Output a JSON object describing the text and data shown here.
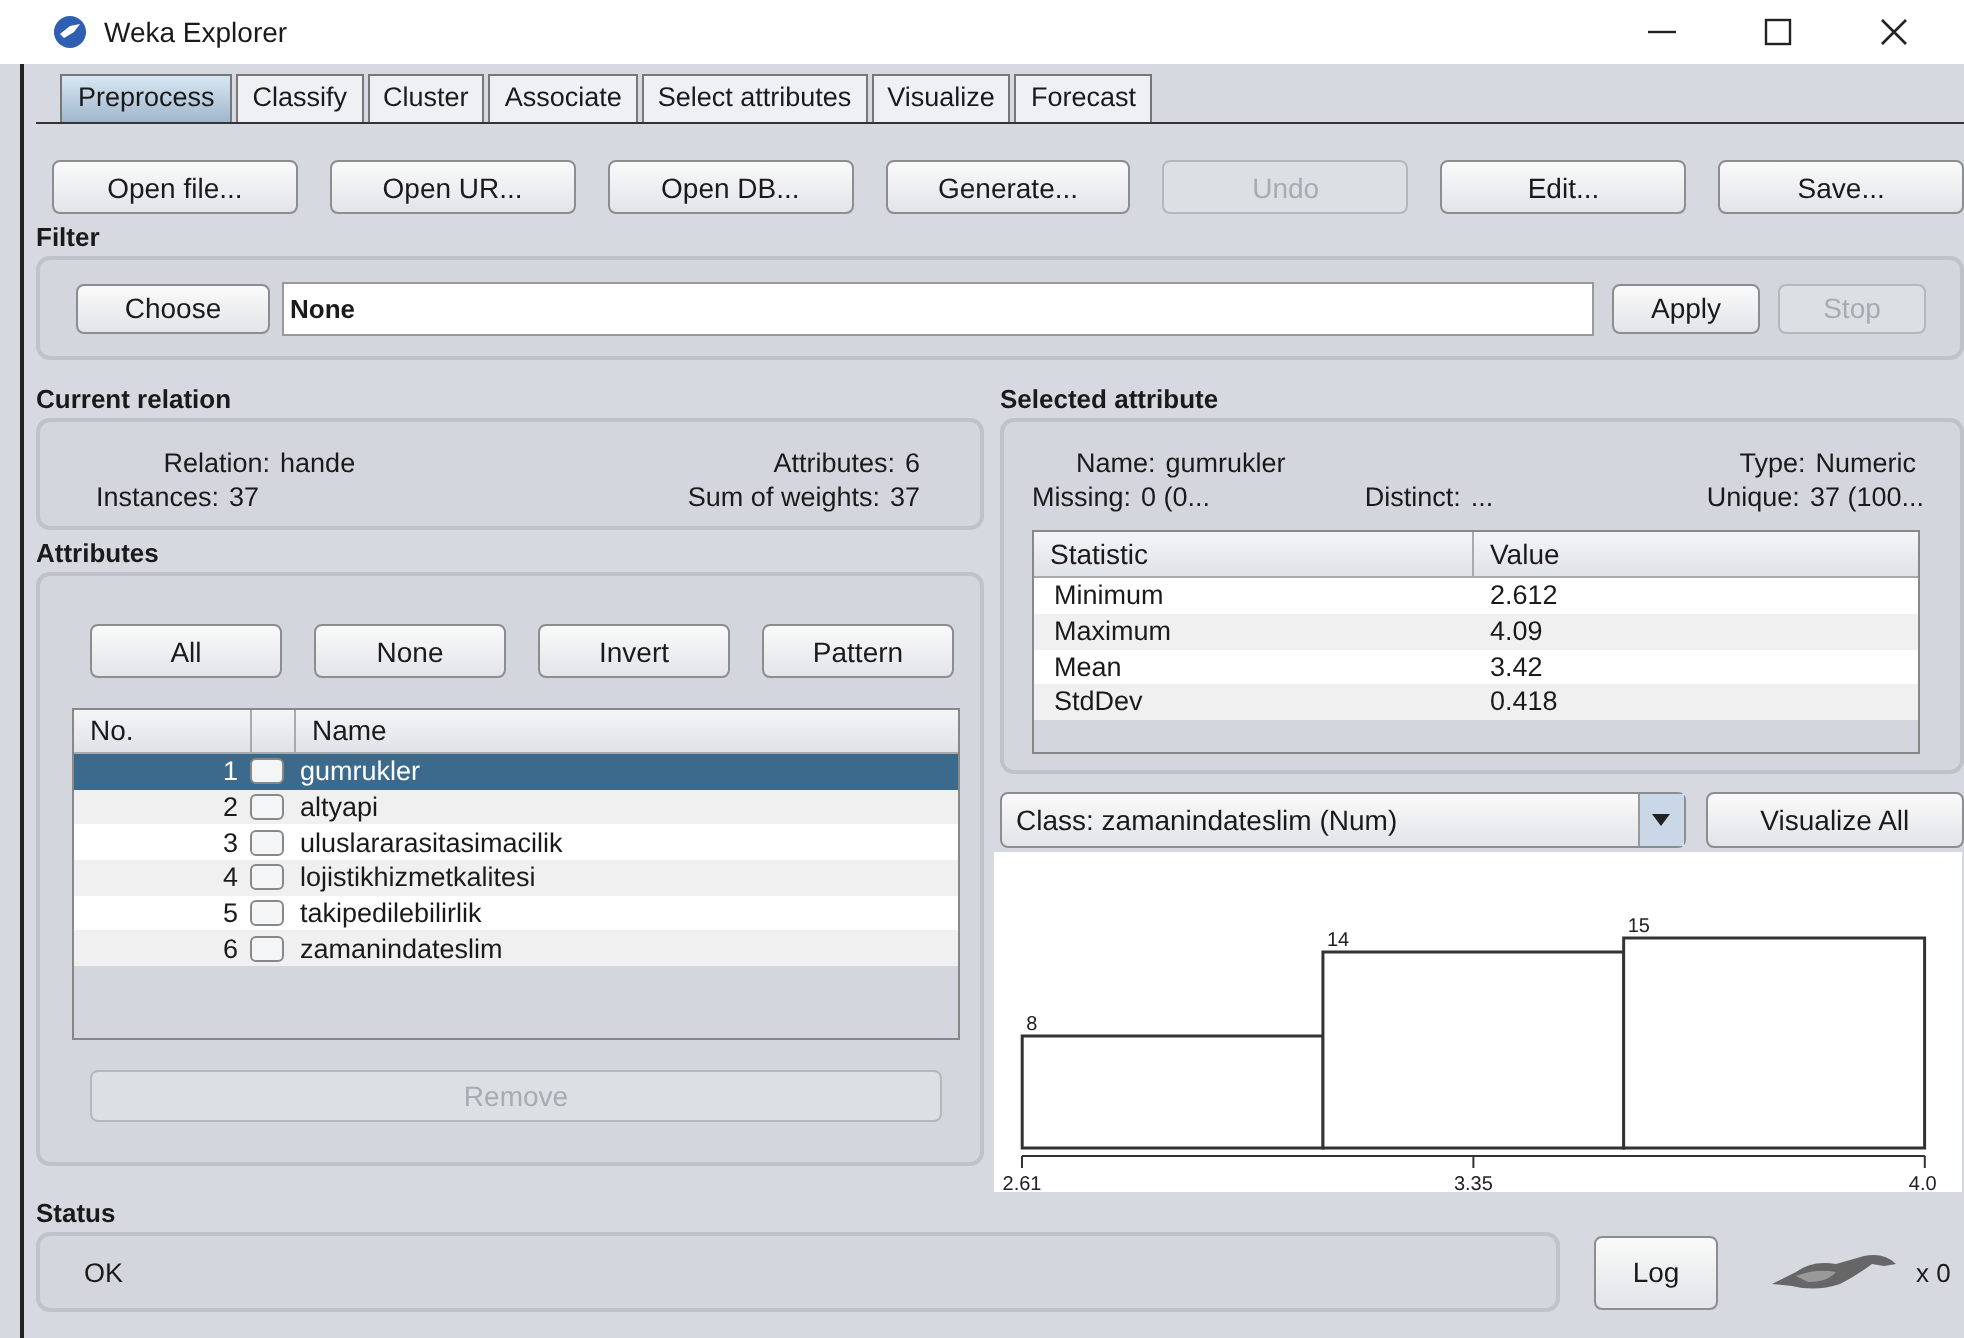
{
  "window": {
    "title": "Weka Explorer"
  },
  "tabs": [
    {
      "label": "Preprocess",
      "selected": true
    },
    {
      "label": "Classify",
      "selected": false
    },
    {
      "label": "Cluster",
      "selected": false
    },
    {
      "label": "Associate",
      "selected": false
    },
    {
      "label": "Select attributes",
      "selected": false
    },
    {
      "label": "Visualize",
      "selected": false
    },
    {
      "label": "Forecast",
      "selected": false
    }
  ],
  "toolbar": [
    {
      "label": "Open file...",
      "disabled": false
    },
    {
      "label": "Open UR...",
      "disabled": false
    },
    {
      "label": "Open DB...",
      "disabled": false
    },
    {
      "label": "Generate...",
      "disabled": false
    },
    {
      "label": "Undo",
      "disabled": true
    },
    {
      "label": "Edit...",
      "disabled": false
    },
    {
      "label": "Save...",
      "disabled": false
    }
  ],
  "filter": {
    "title": "Filter",
    "button": "Choose",
    "value": "None",
    "actions": [
      {
        "label": "Apply",
        "disabled": false
      },
      {
        "label": "Stop",
        "disabled": true
      }
    ]
  },
  "current_relation": {
    "title": "Current relation",
    "fields": [
      {
        "label": "Relation:",
        "value": "hande"
      },
      {
        "label": "Attributes:",
        "value": "6"
      },
      {
        "label": "Instances:",
        "value": "37"
      },
      {
        "label": "Sum of weights:",
        "value": "37"
      }
    ]
  },
  "attributes": {
    "title": "Attributes",
    "buttons": [
      "All",
      "None",
      "Invert",
      "Pattern"
    ],
    "columns": [
      "No.",
      "Name"
    ],
    "rows": [
      {
        "no": "1",
        "name": "gumrukler",
        "checked": false,
        "selected": true
      },
      {
        "no": "2",
        "name": "altyapi",
        "checked": false,
        "selected": false
      },
      {
        "no": "3",
        "name": "uluslararasitasimacilik",
        "checked": false,
        "selected": false
      },
      {
        "no": "4",
        "name": "lojistikhizmetkalitesi",
        "checked": false,
        "selected": false
      },
      {
        "no": "5",
        "name": "takipedilebilirlik",
        "checked": false,
        "selected": false
      },
      {
        "no": "6",
        "name": "zamanindateslim",
        "checked": false,
        "selected": false
      }
    ],
    "remove": {
      "label": "Remove",
      "disabled": true
    }
  },
  "selected_attribute": {
    "title": "Selected attribute",
    "fields": [
      {
        "label": "Name:",
        "value": "gumrukler"
      },
      {
        "label": "Type:",
        "value": "Numeric"
      },
      {
        "label": "Missing:",
        "value": "0 (0..."
      },
      {
        "label": "Distinct:",
        "value": "..."
      },
      {
        "label": "Unique:",
        "value": "37 (100..."
      }
    ],
    "columns": [
      "Statistic",
      "Value"
    ],
    "rows": [
      {
        "statistic": "Minimum",
        "value": "2.612"
      },
      {
        "statistic": "Maximum",
        "value": "4.09"
      },
      {
        "statistic": "Mean",
        "value": "3.42"
      },
      {
        "statistic": "StdDev",
        "value": "0.418"
      }
    ]
  },
  "class_select": {
    "value": "Class: zamanindateslim (Num)"
  },
  "visualize_button": "Visualize All",
  "chart_data": {
    "type": "bar",
    "x": [
      2.857,
      3.35,
      3.843
    ],
    "values": [
      8,
      14,
      15
    ],
    "xlim": [
      2.61,
      4.09
    ],
    "xticks": [
      {
        "value": 2.61,
        "label": "2.61"
      },
      {
        "value": 3.35,
        "label": "3.35"
      }
    ],
    "data_labels": true
  },
  "chart_cut_label": "4.0",
  "status": {
    "title": "Status",
    "message": "OK",
    "log_button": "Log",
    "counter": "x 0"
  }
}
